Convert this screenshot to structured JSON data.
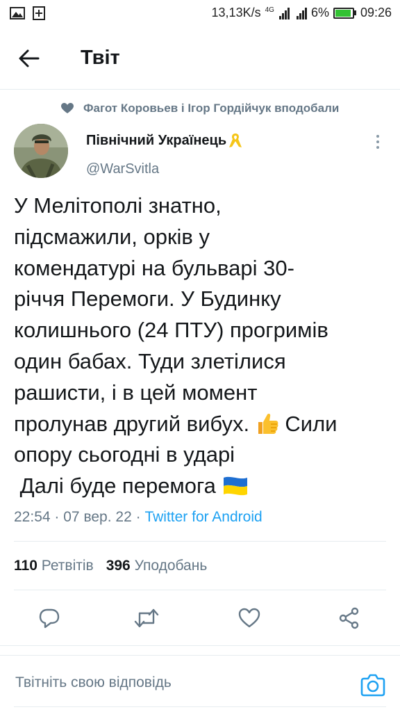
{
  "status_bar": {
    "net_speed": "13,13K/s",
    "network_type": "4G",
    "battery_percent": "6%",
    "time": "09:26",
    "colors": {
      "battery_fill": "#33c233"
    }
  },
  "header": {
    "title": "Твіт",
    "back_icon": "arrow-left-icon"
  },
  "social_context": {
    "text": "Фагот Коровьев і Ігор Гордійчук вподобали",
    "icon": "heart-icon"
  },
  "author": {
    "name": "Північний Українець",
    "name_emoji": "yellow-ribbon-icon",
    "handle": "@WarSvitla"
  },
  "tweet": {
    "lines": [
      "У Мелітополі знатно,",
      "підсмажили, орків у",
      "комендатурі на бульварі 30-",
      "річчя Перемоги. У Будинку",
      "колишнього (24 ПТУ) прогримів",
      "один бабах. Туди злетілися",
      "рашисти, і в цей момент",
      "пролунав другий вибух.",
      "Сили",
      "опору сьогодні в ударі",
      " Далі буде перемога"
    ],
    "emojis": [
      "thumbs-up-icon",
      "ukraine-flag-icon"
    ],
    "time": "22:54",
    "date": "07 вер. 22",
    "separator": "·",
    "source": "Twitter for Android"
  },
  "stats": {
    "retweets_count": "110",
    "retweets_label": "Ретвітів",
    "likes_count": "396",
    "likes_label": "Уподобань"
  },
  "actions": [
    "reply-icon",
    "retweet-icon",
    "like-icon",
    "share-icon"
  ],
  "reply": {
    "placeholder": "Твітніть свою відповідь",
    "camera_icon": "camera-icon"
  },
  "colors": {
    "accent": "#1da1f2",
    "secondary_text": "#657786",
    "primary_text": "#14171a",
    "divider": "#e6ecf0"
  }
}
